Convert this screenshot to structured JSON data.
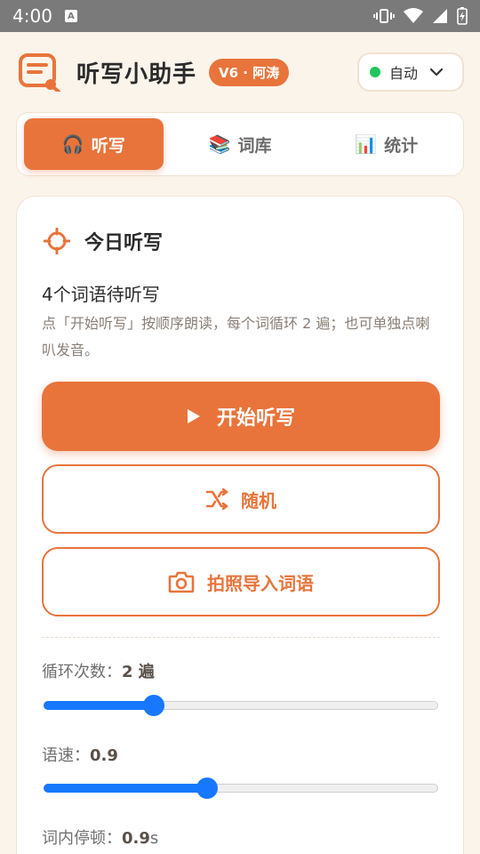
{
  "status_bar": {
    "time": "4:00",
    "notification_icon": "a-icon"
  },
  "header": {
    "app_name": "听写小助手",
    "version_badge": "V6 · 阿涛",
    "mode": {
      "selected": "自动",
      "dot_color": "#22c55e"
    }
  },
  "tabs": [
    {
      "label": "听写",
      "icon": "🎧",
      "active": true
    },
    {
      "label": "词库",
      "icon": "📚",
      "active": false
    },
    {
      "label": "统计",
      "icon": "📊",
      "active": false
    }
  ],
  "card": {
    "title": "今日听写",
    "pending_text": "4个词语待听写",
    "hint_text": "点「开始听写」按顺序朗读，每个词循环 2 遍；也可单独点喇叭发音。",
    "start_button": "开始听写",
    "random_button": "随机",
    "photo_button": "拍照导入词语"
  },
  "settings": {
    "loop": {
      "label": "循环次数：",
      "value": "2 遍",
      "level": 0.27
    },
    "speed": {
      "label": "语速：",
      "value": "0.9",
      "level": 0.41
    },
    "pause": {
      "label": "词内停顿：",
      "value": "0.9",
      "unit": "s"
    }
  },
  "colors": {
    "accent": "#e8743b",
    "background": "#fbf4ea",
    "slider": "#1778ff"
  }
}
